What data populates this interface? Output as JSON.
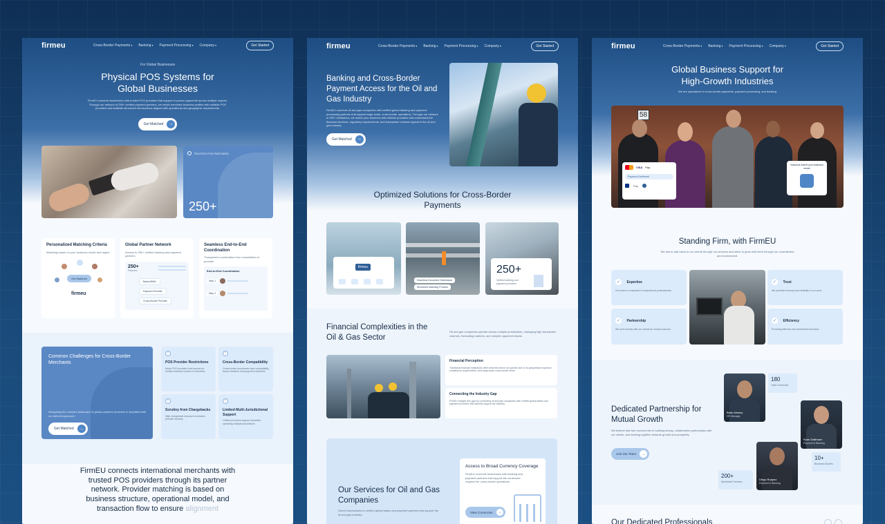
{
  "brand": "firmeu",
  "nav": {
    "links": [
      "Cross-Border Payments",
      "Banking",
      "Payment Processing",
      "Company"
    ],
    "cta": "Get Started"
  },
  "colors": {
    "accent": "#4f86c6",
    "dark": "#152b45",
    "light_card": "#dcebfb",
    "hero_top": "#1d4d82"
  },
  "p1": {
    "eyebrow": "For Global Businesses",
    "title_line1": "Physical POS Systems for",
    "title_line2": "Global Businesses",
    "intro": "FirmEU connects businesses with trusted POS providers that support in-person payments across multiple regions. Through our network of 250+ verified payment partners, we match merchant business profiles with suitable POS providers and facilitate structured introductions aligned with operational and geographic requirements.",
    "cta": "Get Matched",
    "stat_caption": "TRUSTED POS PARTNERS",
    "stat_value": "250+",
    "features": [
      {
        "title": "Personalized Matching Criteria",
        "text": "Matching based on your business model and region"
      },
      {
        "title": "Global Partner Network",
        "text": "Access to 250+ verified banking and payment partners"
      },
      {
        "title": "Seamless End-to-End Coordination",
        "text": "Transparent coordination from consultation to provider"
      }
    ],
    "match_btn": "Get Matched",
    "partners_value": "250+",
    "partners_label": "Partners",
    "partner_items": [
      "Banks/EMIs",
      "Payment Provider",
      "Cross-Border Provider"
    ],
    "coord_title": "End-to-End Coordination",
    "coord_steps": [
      "Step 1",
      "Step 2"
    ],
    "challenges_title": "Common Challenges for Cross-Border Merchants",
    "challenges_text": "Navigating the complex landscape of global payment providers is simplified with our tailored approach.",
    "challenges_cta": "Get Matched",
    "challenges": [
      {
        "title": "POS Provider Restrictions",
        "text": "Many POS providers limit access for certain business models or industries"
      },
      {
        "title": "Cross-Border Compatibility",
        "text": "Cross-border businesses face compatibility issues between local payment networks"
      },
      {
        "title": "Scrutiny from Chargebacks",
        "text": "High chargeback exposure increases provider scrutiny"
      },
      {
        "title": "Limited Multi-Jurisdictional Support",
        "text": "Limited providers support industries operating multiple jurisdictions"
      }
    ],
    "bottom_text": "FirmEU connects international merchants with trusted POS providers through its partner network. Provider matching is based on business structure, operational model, and transaction flow to ensure",
    "bottom_fade": "alignment"
  },
  "p2": {
    "title": "Banking and Cross-Border Payment Access for the Oil and Gas Industry",
    "intro": "FirmEU connects oil and gas companies with verified global banking and payment processing partners that support large-scale, cross-border operations. Through our network of 250+ institutions, we match your business with reliable providers that understand the financial structure, regulatory requirements, and transaction volumes typical in the oil and gas industry.",
    "cta": "Get Matched",
    "solutions_title": "Optimized Solutions for Cross-Border Payments",
    "card_logo": "firmeu",
    "step_items": [
      "Seamless Document Submission",
      "Structured Matching Process"
    ],
    "stat_value": "250+",
    "stat_label": "Verified banking and payment providers",
    "complex_title": "Financial Complexities in the Oil & Gas Sector",
    "complex_text": "Oil and gas companies operate across multiple jurisdictions, managing high transaction volumes, fluctuating markets, and complex payment chains.",
    "items": [
      {
        "title": "Financial Perception",
        "text": "Traditional financial institutions often treat this sector as specific due to its geopolitical exposure, compliance requirements, and large-scale cross-border flows."
      },
      {
        "title": "Connecting the Industry Gap",
        "text": "FirmEU bridges this gap by connecting oil and gas companies with verified global banks and payment providers that actively support the industry."
      }
    ],
    "services_title": "Our Services for Oil and Gas Companies",
    "services_text": "Direct introductions to verified global banks and payment partners that support the oil and gas industry.",
    "access_title": "Access to Broad Currency Coverage",
    "access_text": "FirmEU connects businesses with banking and payment partners that support the currencies required for cross-border operations.",
    "access_btn": "View Currencies"
  },
  "p3": {
    "title_line1": "Global Business Support for",
    "title_line2": "High-Growth Industries",
    "subtitle": "We are specialized in cross-border payments, payment processing, and banking",
    "door_number": "58",
    "pay_badges": [
      "VISA",
      "Pay",
      "Payment Confirmed",
      "Pay"
    ],
    "solutions_label": "Solutions that fit your business model",
    "firm_title": "Standing Firm, with FirmEU",
    "firm_text": "We aim to add value to our clients through our services and strive to grow with them through our commitment and involvement.",
    "values": [
      {
        "title": "Expertise",
        "text": "Our team is composed of experienced professionals."
      },
      {
        "title": "Trust",
        "text": "We prioritise honesty and reliability in our work."
      },
      {
        "title": "Partnership",
        "text": "We work closely with our clients for mutual success."
      },
      {
        "title": "Efficiency",
        "text": "Providing effective and streamlined services."
      }
    ],
    "dedicated_title": "Dedicated Partnership for Mutual Growth",
    "dedicated_text": "We believe that true success lies in building strong, collaborative partnerships with our clients, and working together towards growth and prosperity.",
    "dedicated_btn": "Join Our Team",
    "stats": [
      {
        "value": "180",
        "label": "Total Currencies"
      },
      {
        "value": "10+",
        "label": "Business Models"
      },
      {
        "value": "200+",
        "label": "Worldwide Partners"
      }
    ],
    "people": [
      {
        "name": "Brian Almsey",
        "role": "HR Manager"
      },
      {
        "name": "Ryan Dallmann",
        "role": "Payment & Banking"
      },
      {
        "name": "Diego Ruapez",
        "role": "Payment & Banking"
      }
    ],
    "bottom_title": "Our Dedicated Professionals"
  }
}
